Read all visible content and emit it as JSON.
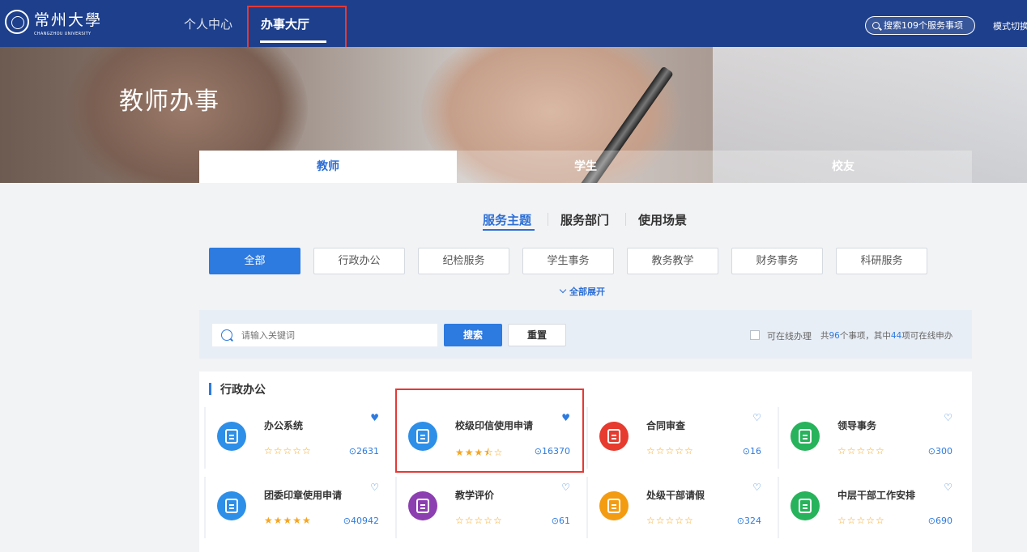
{
  "header": {
    "logo_name": "常州大學",
    "logo_sub": "CHANGZHOU UNIVERSITY",
    "nav": [
      "个人中心",
      "办事大厅"
    ],
    "search_placeholder": "搜索109个服务事项",
    "mode_switch": "模式切换"
  },
  "banner": {
    "title": "教师办事",
    "roles": [
      "教师",
      "学生",
      "校友"
    ]
  },
  "categories": [
    "服务主题",
    "服务部门",
    "使用场景"
  ],
  "filters": [
    "全部",
    "行政办公",
    "纪检服务",
    "学生事务",
    "教务教学",
    "财务事务",
    "科研服务"
  ],
  "expand_label": "全部展开",
  "search": {
    "placeholder": "请输入关键词",
    "search_btn": "搜索",
    "reset_btn": "重置",
    "online_label": "可在线办理",
    "count_prefix": "共",
    "total": "96",
    "count_mid": "个事项，其中",
    "online": "44",
    "count_suffix": "项可在线申办"
  },
  "section": {
    "title": "行政办公",
    "cards": [
      {
        "title": "办公系统",
        "stars": "☆☆☆☆☆",
        "views": "⊙2631",
        "heart": "♥",
        "color": "#2d8fe8"
      },
      {
        "title": "校级印信使用申请",
        "stars": "★★★⯪☆",
        "views": "⊙16370",
        "heart": "♥",
        "color": "#2d8fe8"
      },
      {
        "title": "合同审查",
        "stars": "☆☆☆☆☆",
        "views": "⊙16",
        "heart": "♡",
        "color": "#e63b2e"
      },
      {
        "title": "领导事务",
        "stars": "☆☆☆☆☆",
        "views": "⊙300",
        "heart": "♡",
        "color": "#27b35b"
      },
      {
        "title": "团委印章使用申请",
        "stars": "★★★★★",
        "views": "⊙40942",
        "heart": "♡",
        "color": "#2d8fe8"
      },
      {
        "title": "教学评价",
        "stars": "☆☆☆☆☆",
        "views": "⊙61",
        "heart": "♡",
        "color": "#8c3fb0"
      },
      {
        "title": "处级干部请假",
        "stars": "☆☆☆☆☆",
        "views": "⊙324",
        "heart": "♡",
        "color": "#f39c12"
      },
      {
        "title": "中层干部工作安排",
        "stars": "☆☆☆☆☆",
        "views": "⊙690",
        "heart": "♡",
        "color": "#27b35b"
      }
    ]
  },
  "colors": {
    "nav_bg": "#1d3f8c",
    "accent": "#2d7ae0",
    "highlight_box": "#e53935"
  }
}
